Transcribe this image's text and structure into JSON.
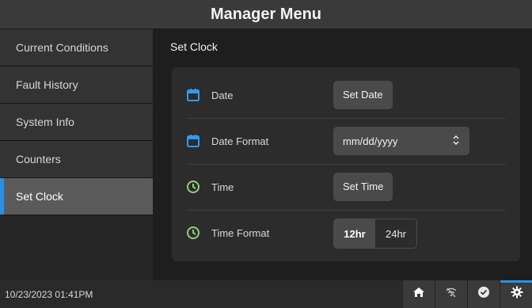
{
  "header": {
    "title": "Manager Menu"
  },
  "sidebar": {
    "items": [
      {
        "label": "Current Conditions"
      },
      {
        "label": "Fault History"
      },
      {
        "label": "System Info"
      },
      {
        "label": "Counters"
      },
      {
        "label": "Set Clock"
      }
    ],
    "active_index": 4
  },
  "main": {
    "section_title": "Set Clock",
    "rows": {
      "date": {
        "label": "Date",
        "button": "Set Date",
        "icon": "calendar-icon"
      },
      "date_format": {
        "label": "Date Format",
        "value": "mm/dd/yyyy",
        "icon": "calendar-icon"
      },
      "time": {
        "label": "Time",
        "button": "Set Time",
        "icon": "clock-icon"
      },
      "time_format": {
        "label": "Time Format",
        "options": [
          "12hr",
          "24hr"
        ],
        "selected": "12hr",
        "icon": "clock-icon"
      }
    }
  },
  "statusbar": {
    "datetime": "10/23/2023 01:41PM",
    "buttons": [
      "home-icon",
      "wifi-off-icon",
      "check-icon",
      "gear-icon"
    ],
    "active_button": "gear-icon"
  },
  "colors": {
    "accent": "#2f8fde",
    "calendar_icon": "#2f9bf0",
    "clock_icon": "#8fcf7a"
  }
}
